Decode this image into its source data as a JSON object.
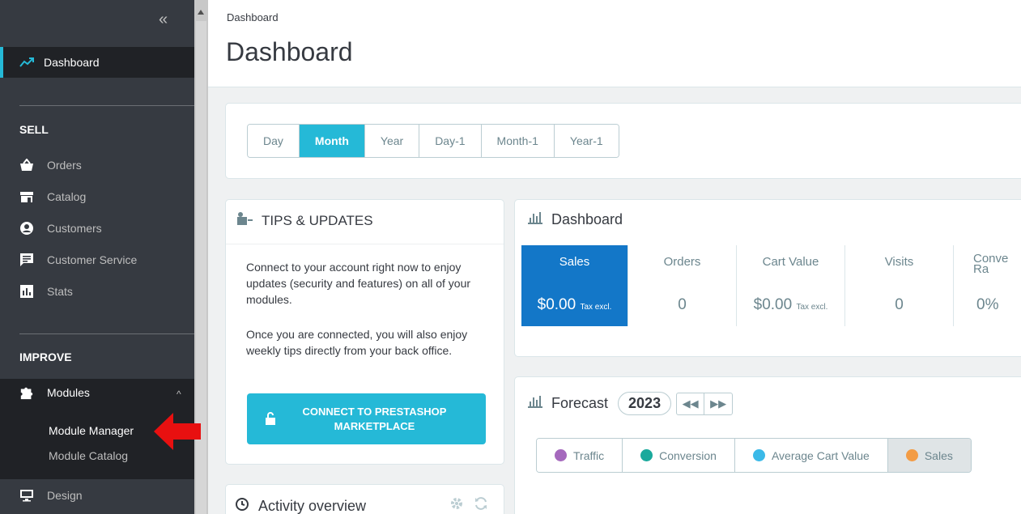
{
  "sidebar": {
    "collapse_icon": "double-chevron-left-icon",
    "dashboard": "Dashboard",
    "sell_header": "SELL",
    "sell_items": [
      "Orders",
      "Catalog",
      "Customers",
      "Customer Service",
      "Stats"
    ],
    "improve_header": "IMPROVE",
    "modules": "Modules",
    "module_manager": "Module Manager",
    "module_catalog": "Module Catalog",
    "design": "Design",
    "accent_color": "#25b9d7"
  },
  "header": {
    "breadcrumb": "Dashboard",
    "title": "Dashboard"
  },
  "periods": {
    "buttons": [
      "Day",
      "Month",
      "Year",
      "Day-1",
      "Month-1",
      "Year-1"
    ],
    "active": "Month"
  },
  "tips": {
    "title": "TIPS & UPDATES",
    "para1": "Connect to your account right now to enjoy updates (security and features) on all of your modules.",
    "para2": "Once you are connected, you will also enjoy weekly tips directly from your back office.",
    "connect_button": "CONNECT TO PRESTASHOP MARKETPLACE"
  },
  "dashboard_card": {
    "title": "Dashboard",
    "kpis": [
      {
        "name": "Sales",
        "value": "$0.00",
        "suffix": "Tax excl."
      },
      {
        "name": "Orders",
        "value": "0",
        "suffix": ""
      },
      {
        "name": "Cart Value",
        "value": "$0.00",
        "suffix": "Tax excl."
      },
      {
        "name": "Visits",
        "value": "0",
        "suffix": ""
      },
      {
        "name": "Conve\nRa",
        "value": "0%",
        "suffix": ""
      }
    ]
  },
  "forecast": {
    "title": "Forecast",
    "year": "2023",
    "filters": [
      {
        "label": "Traffic",
        "color": "#a569bd"
      },
      {
        "label": "Conversion",
        "color": "#1aa99c"
      },
      {
        "label": "Average Cart Value",
        "color": "#3bb9e8"
      },
      {
        "label": "Sales",
        "color": "#f39c45"
      }
    ],
    "active": "Sales"
  },
  "activity": {
    "title": "Activity overview"
  }
}
